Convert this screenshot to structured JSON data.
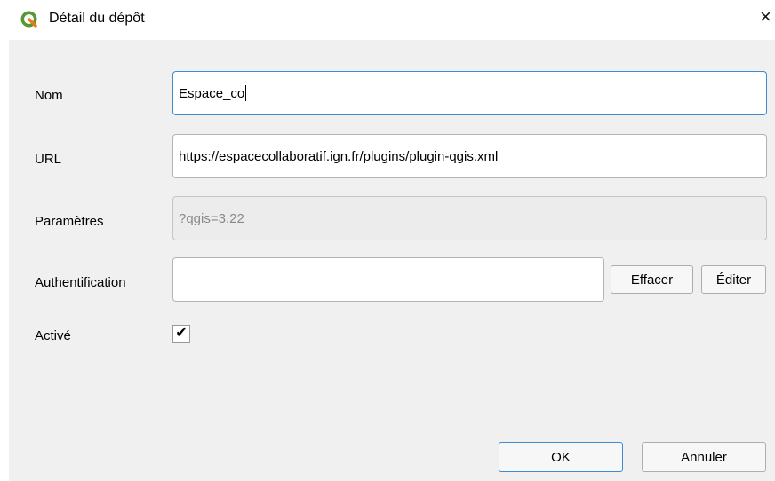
{
  "window": {
    "title": "Détail du dépôt",
    "close_glyph": "×",
    "icon": "qgis-logo-icon"
  },
  "form": {
    "name": {
      "label": "Nom",
      "value": "Espace_co"
    },
    "url": {
      "label": "URL",
      "value": "https://espacecollaboratif.ign.fr/plugins/plugin-qgis.xml"
    },
    "params": {
      "label": "Paramètres",
      "value": "?qgis=3.22"
    },
    "auth": {
      "label": "Authentification",
      "value": "",
      "clear_label": "Effacer",
      "edit_label": "Éditer"
    },
    "enabled": {
      "label": "Activé",
      "checked": true,
      "check_glyph": "✔"
    }
  },
  "buttons": {
    "ok": "OK",
    "cancel": "Annuler"
  },
  "colors": {
    "focus": "#3d8bd0",
    "qgis_green": "#589632",
    "qgis_yellow": "#ee7913"
  }
}
